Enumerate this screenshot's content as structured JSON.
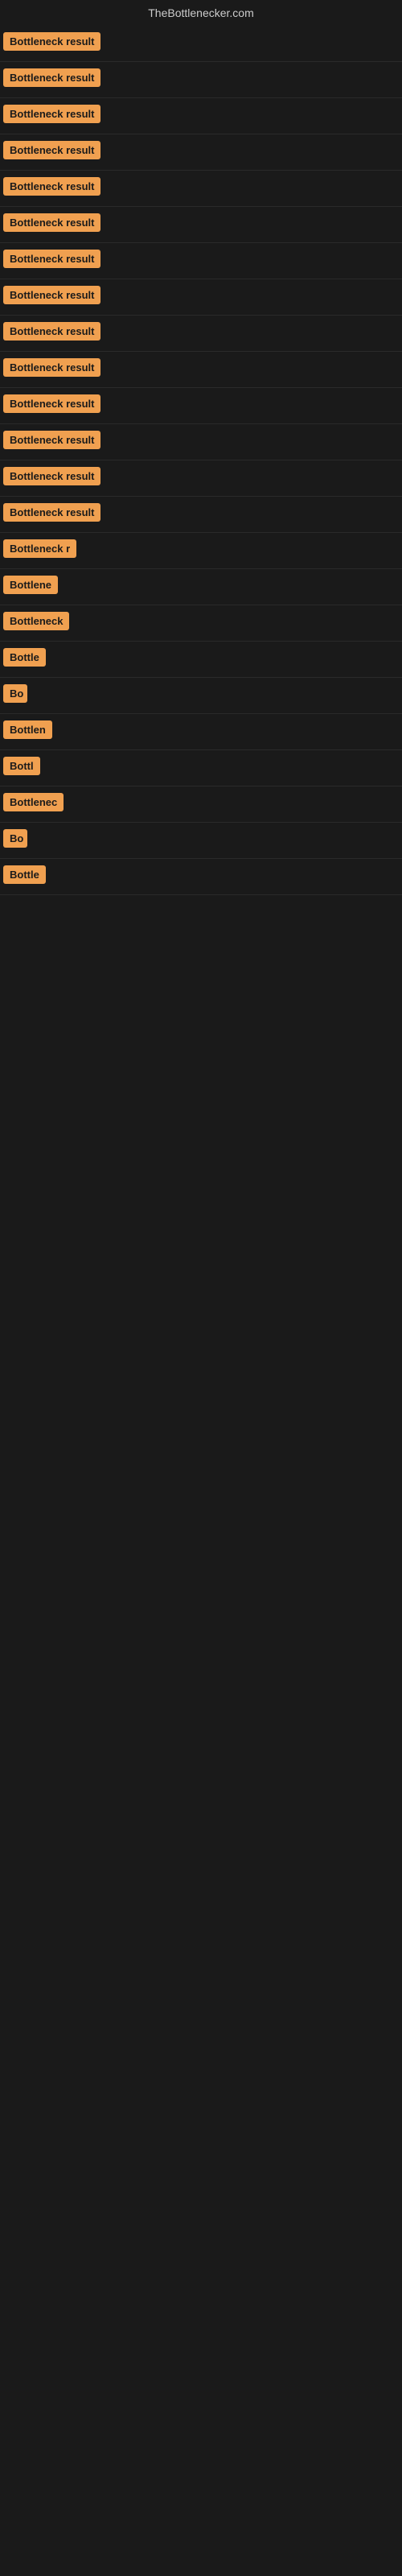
{
  "site": {
    "title": "TheBottlenecker.com"
  },
  "rows": [
    {
      "id": 1,
      "label": "Bottleneck result",
      "width": 160
    },
    {
      "id": 2,
      "label": "Bottleneck result",
      "width": 160
    },
    {
      "id": 3,
      "label": "Bottleneck result",
      "width": 160
    },
    {
      "id": 4,
      "label": "Bottleneck result",
      "width": 160
    },
    {
      "id": 5,
      "label": "Bottleneck result",
      "width": 160
    },
    {
      "id": 6,
      "label": "Bottleneck result",
      "width": 160
    },
    {
      "id": 7,
      "label": "Bottleneck result",
      "width": 160
    },
    {
      "id": 8,
      "label": "Bottleneck result",
      "width": 160
    },
    {
      "id": 9,
      "label": "Bottleneck result",
      "width": 160
    },
    {
      "id": 10,
      "label": "Bottleneck result",
      "width": 160
    },
    {
      "id": 11,
      "label": "Bottleneck result",
      "width": 160
    },
    {
      "id": 12,
      "label": "Bottleneck result",
      "width": 160
    },
    {
      "id": 13,
      "label": "Bottleneck result",
      "width": 160
    },
    {
      "id": 14,
      "label": "Bottleneck result",
      "width": 155
    },
    {
      "id": 15,
      "label": "Bottleneck r",
      "width": 100
    },
    {
      "id": 16,
      "label": "Bottlene",
      "width": 80
    },
    {
      "id": 17,
      "label": "Bottleneck",
      "width": 88
    },
    {
      "id": 18,
      "label": "Bottle",
      "width": 62
    },
    {
      "id": 19,
      "label": "Bo",
      "width": 30
    },
    {
      "id": 20,
      "label": "Bottlen",
      "width": 70
    },
    {
      "id": 21,
      "label": "Bottl",
      "width": 55
    },
    {
      "id": 22,
      "label": "Bottlenec",
      "width": 84
    },
    {
      "id": 23,
      "label": "Bo",
      "width": 30
    },
    {
      "id": 24,
      "label": "Bottle",
      "width": 62
    }
  ]
}
